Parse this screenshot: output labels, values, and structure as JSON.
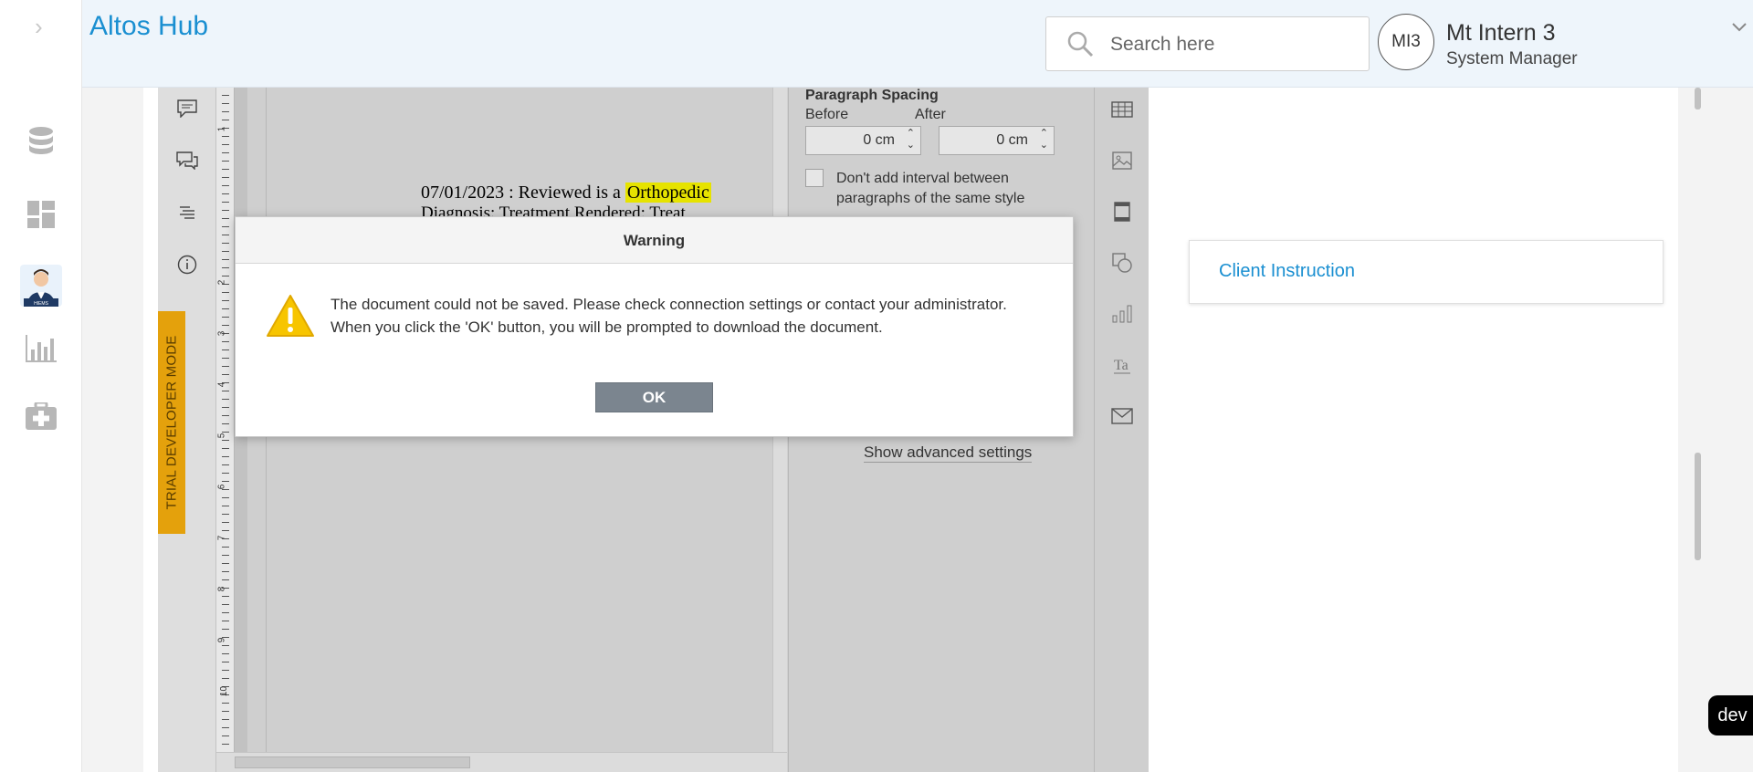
{
  "app": {
    "title": "Altos Hub"
  },
  "search": {
    "placeholder": "Search here"
  },
  "user": {
    "initials": "MI3",
    "name": "Mt Intern 3",
    "role": "System Manager"
  },
  "sidebar": {
    "items": [
      {
        "icon": "database-icon"
      },
      {
        "icon": "dashboard-icon"
      },
      {
        "icon": "doctor-avatar-icon",
        "caption": "HIEMS"
      },
      {
        "icon": "bar-chart-icon"
      },
      {
        "icon": "medical-kit-icon"
      }
    ]
  },
  "editor": {
    "trial_label": "TRIAL DEVELOPER MODE",
    "doc_line1_pre": "07/01/2023  :   Reviewed  is  a ",
    "doc_line1_highlight": "Orthopedic",
    "doc_line2": "Diagnosis:    Treatment Rendered:    Treat",
    "ruler_numbers": [
      "1",
      "2",
      "3",
      "4",
      "5",
      "6",
      "7",
      "8",
      "9",
      "10"
    ],
    "props": {
      "title": "Paragraph Spacing",
      "before_label": "Before",
      "after_label": "After",
      "before_value": "0 cm",
      "after_value": "0 cm",
      "checkbox_label": "Don't add interval between paragraphs of the same style",
      "checkbox_checked": false,
      "advanced_link": "Show advanced settings"
    }
  },
  "client_instruction": {
    "label": "Client Instruction"
  },
  "dev_badge": {
    "label": "dev"
  },
  "dialog": {
    "title": "Warning",
    "message_line1": "The document could not be saved. Please check connection settings or contact your administrator.",
    "message_line2": "When you click the 'OK' button, you will be prompted to download the document.",
    "ok_label": "OK"
  },
  "colors": {
    "brand": "#1a8fd1",
    "trial": "#e4a10c",
    "highlight": "#e6e300",
    "ok_button": "#7b858f"
  }
}
